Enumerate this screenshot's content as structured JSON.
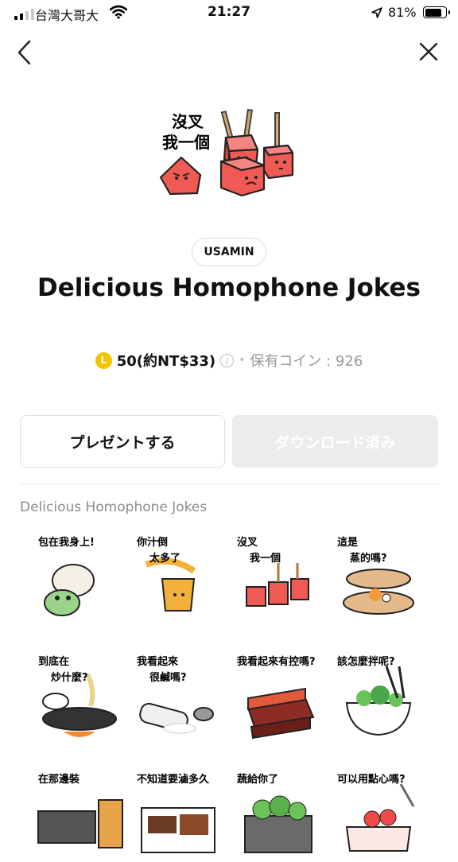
{
  "status_bar": {
    "carrier": "台灣大哥大",
    "time": "21:27",
    "battery": "81%",
    "battery_level": 0.81,
    "signal_bars": 2,
    "icons": [
      "signal-icon",
      "wifi-icon",
      "location-arrow-icon",
      "battery-icon"
    ]
  },
  "nav": {
    "back_icon": "chevron-left-icon",
    "close_icon": "close-icon"
  },
  "product": {
    "author": "USAMIN",
    "title": "Delicious Homophone Jokes",
    "coin_letter": "L",
    "price": "50(約NT$33)",
    "info_symbol": "i",
    "separator": "•",
    "owned_coins": "保有コイン : 926"
  },
  "actions": {
    "gift_label": "プレゼントする",
    "download_label": "ダウンロード済み"
  },
  "section": {
    "title": "Delicious Homophone Jokes"
  },
  "stickers": [
    {
      "caption": "包在我身上!"
    },
    {
      "caption": "你汁倒 太多了"
    },
    {
      "caption": "沒叉 我一個"
    },
    {
      "caption": "這是 蒸的嗎?"
    },
    {
      "caption": "到底在 炒什麼?"
    },
    {
      "caption": "我看起來 很鹹嗎?"
    },
    {
      "caption": "我看起來有控嗎?"
    },
    {
      "caption": "該怎麼拌呢?"
    },
    {
      "caption": "在那邊裝"
    },
    {
      "caption": "不知道要滷多久"
    },
    {
      "caption": "蔬給你了"
    },
    {
      "caption": "可以用點心嗎?"
    }
  ],
  "hero_caption_lines": [
    "沒叉",
    "我一個"
  ],
  "colors": {
    "accent_red": "#ee5a55",
    "coin": "#f5c400",
    "text_gray": "#8c8c8c",
    "button_disabled": "#ececec"
  }
}
